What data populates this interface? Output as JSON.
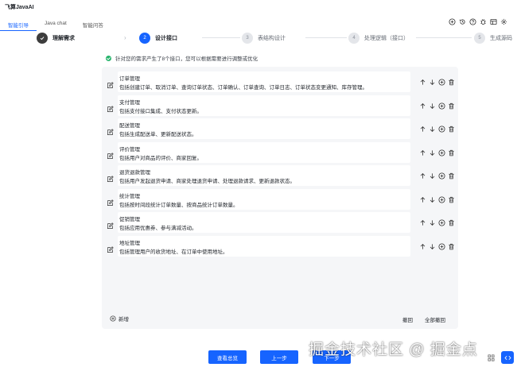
{
  "app": {
    "title": "飞算JavaAI"
  },
  "nav_tabs": [
    {
      "label": "智能引导",
      "active": true
    },
    {
      "label": "Java chat",
      "active": false
    },
    {
      "label": "智能问答",
      "active": false
    }
  ],
  "toolbar_icons": [
    "add-circle-icon",
    "history-icon",
    "help-icon",
    "bug-icon",
    "layout-icon",
    "settings-icon"
  ],
  "steps": [
    {
      "number": "",
      "label": "理解需求",
      "state": "done"
    },
    {
      "number": "2",
      "label": "设计接口",
      "state": "active"
    },
    {
      "number": "3",
      "label": "表结构设计",
      "state": "pending"
    },
    {
      "number": "4",
      "label": "处理逻辑（接口）",
      "state": "pending"
    },
    {
      "number": "5",
      "label": "生成源码",
      "state": "pending"
    }
  ],
  "notice": {
    "text": "针对您的需求产生了8个接口，您可以根据需要进行调整或优化"
  },
  "interfaces": [
    {
      "title": "订单管理",
      "desc": "包括创建订单、取消订单、查询订单状态、订单确认、订单查询、订单日志、订单状态变更通知、库存管理。"
    },
    {
      "title": "支付管理",
      "desc": "包括支付接口集成、支付状态更新。"
    },
    {
      "title": "配送管理",
      "desc": "包括生成配送单、更新配送状态。"
    },
    {
      "title": "评价管理",
      "desc": "包括用户对商品的评价、商家回复。"
    },
    {
      "title": "退货退款管理",
      "desc": "包括用户发起退货申请、商家处理退货申请、处理退款请求、更新退款状态。"
    },
    {
      "title": "统计管理",
      "desc": "包括按时间段统计订单数量、按商品统计订单数量。"
    },
    {
      "title": "促销管理",
      "desc": "包括应用优惠券、参与满减活动。"
    },
    {
      "title": "地址管理",
      "desc": "包括管理用户的收货地址、在订单中使用地址。"
    }
  ],
  "panel_actions": {
    "add_label": "新增",
    "undo_label": "撤回",
    "undo_all_label": "全部撤回"
  },
  "bottom_buttons": {
    "view_all_label": "查看总览",
    "prev_label": "上一步",
    "next_label": "下一步"
  },
  "watermark": {
    "text": "掘金技术社区 @ 掘金点"
  },
  "colors": {
    "accent": "#1664ff",
    "success": "#26b36b",
    "panel_bg": "#f5f6f8"
  }
}
